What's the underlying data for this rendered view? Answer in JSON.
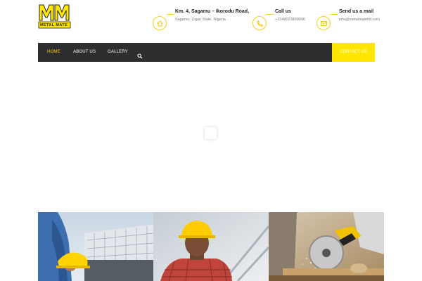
{
  "header": {
    "logo": {
      "text": "METAL MATE",
      "monogram": "MM"
    },
    "contacts": [
      {
        "title": "Km. 4, Sagamu – Ikorodu Road,",
        "subtitle": "Sagamu, Ogun State, Nigeria",
        "icon": "home-icon"
      },
      {
        "title": "Call us",
        "subtitle": "+2348023899996",
        "icon": "phone-icon"
      },
      {
        "title": "Send us a mail",
        "subtitle": "info@metalmateltd.com",
        "icon": "mail-icon"
      }
    ]
  },
  "nav": {
    "items": [
      {
        "label": "HOME",
        "active": true
      },
      {
        "label": "ABOUT US",
        "active": false
      },
      {
        "label": "GALLERY",
        "active": false
      }
    ],
    "search_icon": "search-icon",
    "cta_label": "CONTACT US"
  },
  "colors": {
    "accent": "#ffe600",
    "nav_background": "#2e2e2e",
    "icon_ring": "#f2d21a"
  },
  "photos": [
    {
      "subject": "worker-holding-hard-hat"
    },
    {
      "subject": "worker-wearing-yellow-hard-hat"
    },
    {
      "subject": "mitre-saw-cutting-wood"
    }
  ]
}
